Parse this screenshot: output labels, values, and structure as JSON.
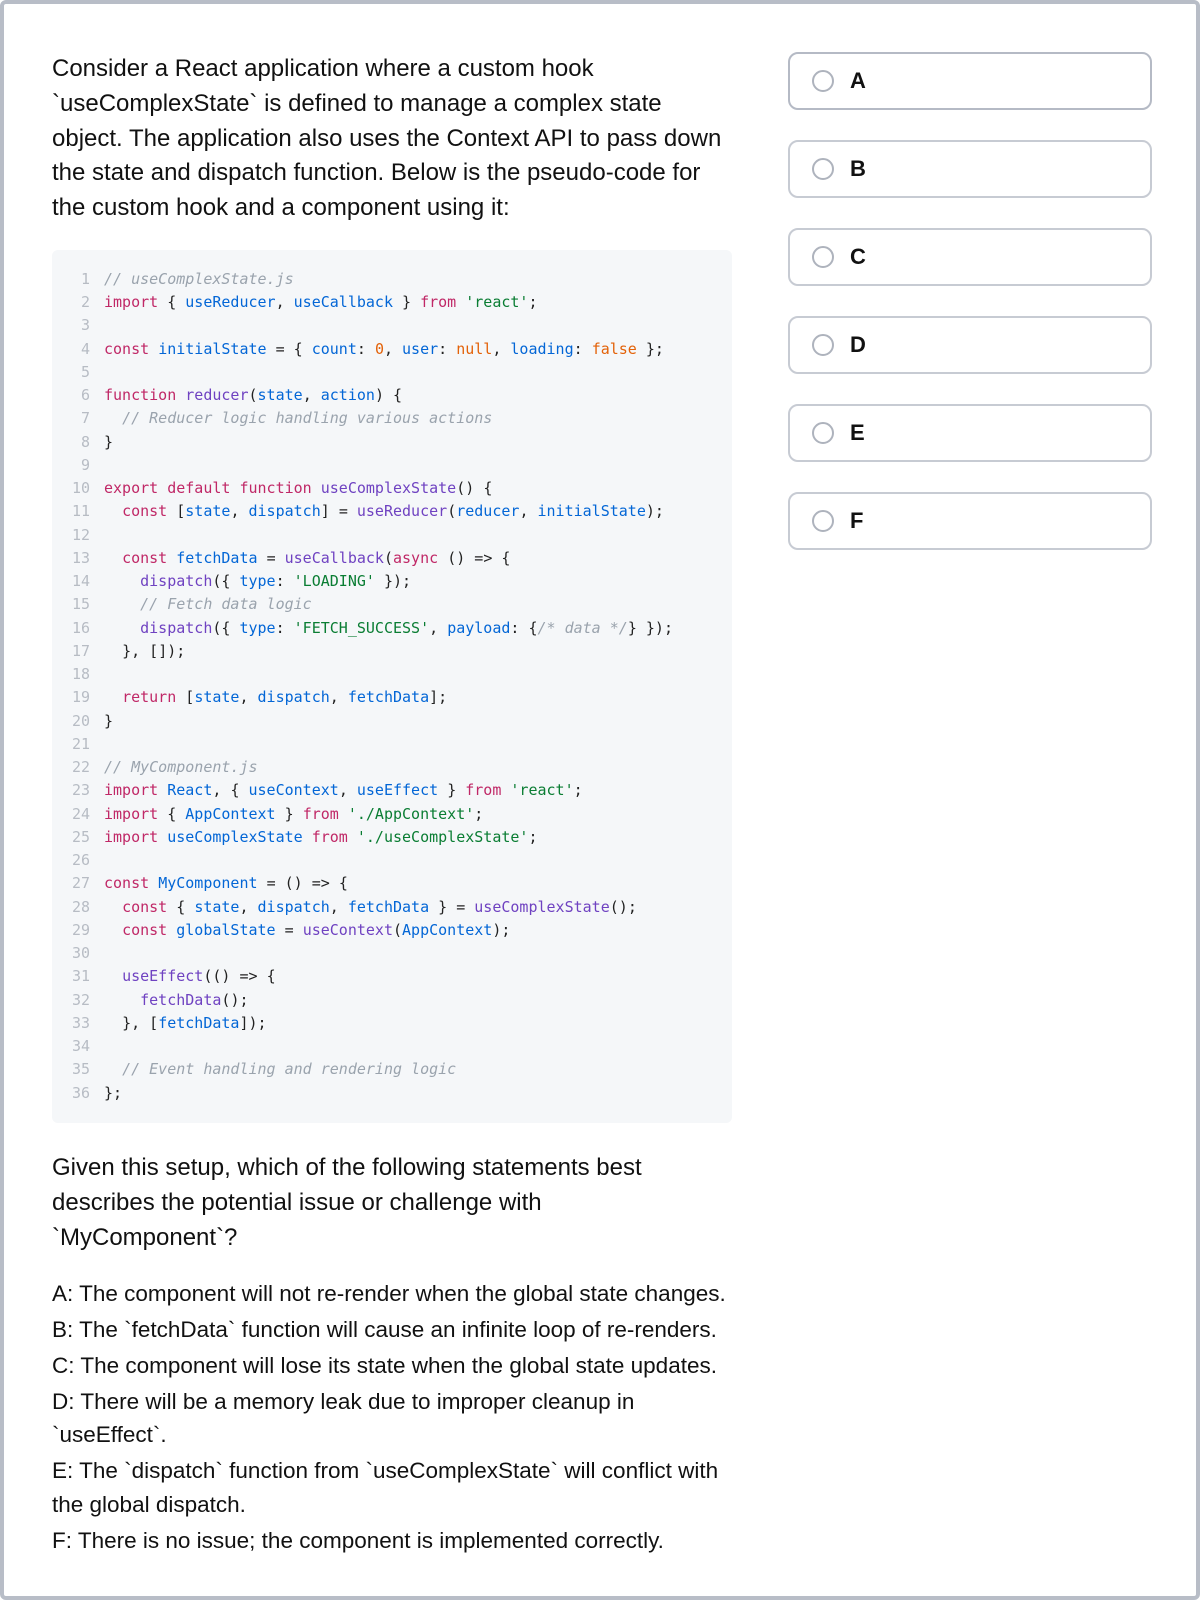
{
  "question": {
    "intro": "Consider a React application where a custom hook `useComplexState` is defined to manage a complex state object. The application also uses the Context API to pass down the state and dispatch function. Below is the pseudo-code for the custom hook and a component using it:",
    "followup": "Given this setup, which of the following statements best describes the potential issue or challenge with `MyComponent`?",
    "options_text": {
      "A": "A: The component will not re-render when the global state changes.",
      "B": "B: The `fetchData` function will cause an infinite loop of re-renders.",
      "C": "C: The component will lose its state when the global state updates.",
      "D": "D: There will be a memory leak due to improper cleanup in `useEffect`.",
      "E": "E: The `dispatch` function from `useComplexState` will conflict with the global dispatch.",
      "F": "F: There is no issue; the component is implemented correctly."
    }
  },
  "code_lines": {
    "1": {
      "comment": "// useComplexState.js"
    },
    "2": {
      "raw": "import { useReducer, useCallback } from 'react';"
    },
    "3": {
      "blank": true
    },
    "4": {
      "raw": "const initialState = { count: 0, user: null, loading: false };"
    },
    "5": {
      "blank": true
    },
    "6": {
      "raw": "function reducer(state, action) {"
    },
    "7": {
      "comment_indented": "  // Reducer logic handling various actions"
    },
    "8": {
      "raw": "}"
    },
    "9": {
      "blank": true
    },
    "10": {
      "raw": "export default function useComplexState() {"
    },
    "11": {
      "raw": "  const [state, dispatch] = useReducer(reducer, initialState);"
    },
    "12": {
      "blank": true
    },
    "13": {
      "raw": "  const fetchData = useCallback(async () => {"
    },
    "14": {
      "raw": "    dispatch({ type: 'LOADING' });"
    },
    "15": {
      "comment_indented": "    // Fetch data logic"
    },
    "16": {
      "raw": "    dispatch({ type: 'FETCH_SUCCESS', payload: {/* data */} });"
    },
    "17": {
      "raw": "  }, []);"
    },
    "18": {
      "blank": true
    },
    "19": {
      "raw": "  return [state, dispatch, fetchData];"
    },
    "20": {
      "raw": "}"
    },
    "21": {
      "blank": true
    },
    "22": {
      "comment": "// MyComponent.js"
    },
    "23": {
      "raw": "import React, { useContext, useEffect } from 'react';"
    },
    "24": {
      "raw": "import { AppContext } from './AppContext';"
    },
    "25": {
      "raw": "import useComplexState from './useComplexState';"
    },
    "26": {
      "blank": true
    },
    "27": {
      "raw": "const MyComponent = () => {"
    },
    "28": {
      "raw": "  const { state, dispatch, fetchData } = useComplexState();"
    },
    "29": {
      "raw": "  const globalState = useContext(AppContext);"
    },
    "30": {
      "blank": true
    },
    "31": {
      "raw": "  useEffect(() => {"
    },
    "32": {
      "raw": "    fetchData();"
    },
    "33": {
      "raw": "  }, [fetchData]);"
    },
    "34": {
      "blank": true
    },
    "35": {
      "comment_indented": "  // Event handling and rendering logic"
    },
    "36": {
      "raw": "};"
    }
  },
  "answers": [
    {
      "label": "A"
    },
    {
      "label": "B"
    },
    {
      "label": "C"
    },
    {
      "label": "D"
    },
    {
      "label": "E"
    },
    {
      "label": "F"
    }
  ]
}
